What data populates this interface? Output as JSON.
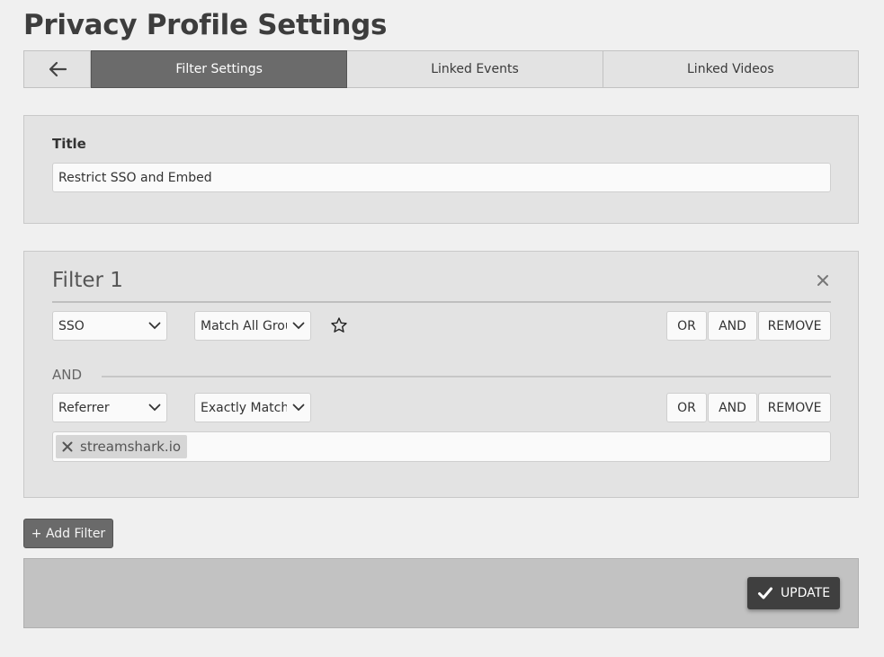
{
  "page": {
    "title": "Privacy Profile Settings"
  },
  "tabs": [
    {
      "label": "Filter Settings",
      "active": true
    },
    {
      "label": "Linked Events",
      "active": false
    },
    {
      "label": "Linked Videos",
      "active": false
    }
  ],
  "title_section": {
    "label": "Title",
    "value": "Restrict SSO and Embed"
  },
  "filter": {
    "heading": "Filter 1",
    "rows": [
      {
        "type_select": "SSO",
        "match_select": "Match All Grou",
        "buttons": {
          "or": "OR",
          "and": "AND",
          "remove": "REMOVE"
        }
      },
      {
        "type_select": "Referrer",
        "match_select": "Exactly Match",
        "buttons": {
          "or": "OR",
          "and": "AND",
          "remove": "REMOVE"
        },
        "tags": [
          "streamshark.io"
        ]
      }
    ],
    "connector_label": "AND"
  },
  "actions": {
    "add_filter": "+ Add Filter",
    "update": "UPDATE"
  },
  "colors": {
    "active_tab": "#6b6b6b",
    "update_button": "#3f3f3f",
    "background": "#f0f0f0"
  },
  "icons": {
    "back": "arrow-left-icon",
    "close": "close-icon",
    "chevron": "chevron-down-icon",
    "star": "star-outline-icon",
    "tag_remove": "close-icon",
    "update": "check-icon"
  }
}
